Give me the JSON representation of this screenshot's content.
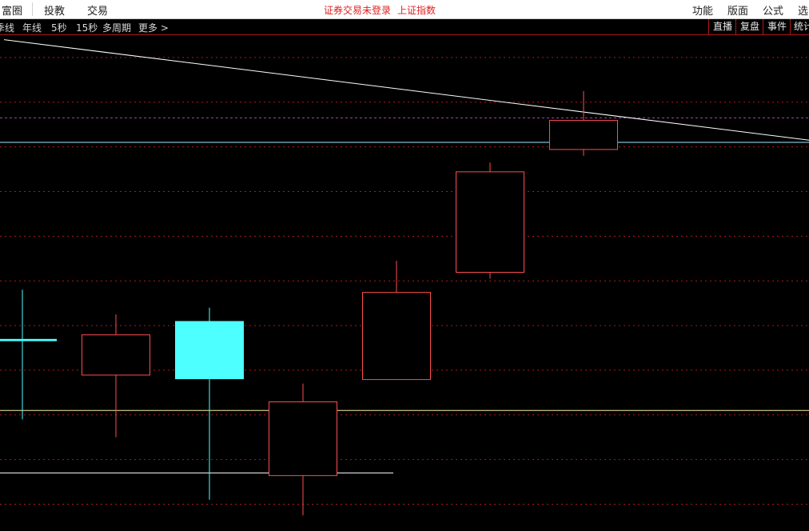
{
  "topbar": {
    "brand": "富圈",
    "menu": [
      "投教",
      "交易"
    ],
    "status": "证券交易未登录",
    "index_name": "上证指数",
    "right_menu": [
      "功能",
      "版面",
      "公式",
      "选"
    ]
  },
  "periods": {
    "items": [
      "季线",
      "年线",
      "5秒",
      "15秒",
      "多周期"
    ],
    "more": "更多",
    "right_buttons": [
      "直播",
      "复盘",
      "事件",
      "统计"
    ]
  },
  "colors": {
    "up": "#ff4d4d",
    "down": "#4dffff",
    "grid": "#b01818",
    "purple": "#b040b0",
    "trend": "#ffffff",
    "cyan_line": "#a0e8ff",
    "yellow_line": "#f5f098"
  },
  "chart_data": {
    "type": "candlestick",
    "candles": [
      {
        "open": 86,
        "close": 85,
        "high": 108,
        "low": 50
      },
      {
        "open": 70,
        "close": 88,
        "high": 97,
        "low": 42
      },
      {
        "open": 94,
        "close": 68,
        "high": 100,
        "low": 14
      },
      {
        "open": 25,
        "close": 58,
        "high": 66,
        "low": 7
      },
      {
        "open": 68,
        "close": 107,
        "high": 121,
        "low": 68
      },
      {
        "open": 116,
        "close": 161,
        "high": 165,
        "low": 113
      },
      {
        "open": 171,
        "close": 184,
        "high": 197,
        "low": 168
      }
    ],
    "ylim": [
      0,
      222
    ],
    "grid": true,
    "trend_line": {
      "start": 220,
      "end": 175
    },
    "price_lines": [
      {
        "name": "cyan",
        "value": 174,
        "extent": "full"
      },
      {
        "name": "yellow",
        "value": 54,
        "extent": "full"
      },
      {
        "name": "white",
        "value": 26,
        "extent": "partial"
      }
    ],
    "purple_level": 185
  }
}
